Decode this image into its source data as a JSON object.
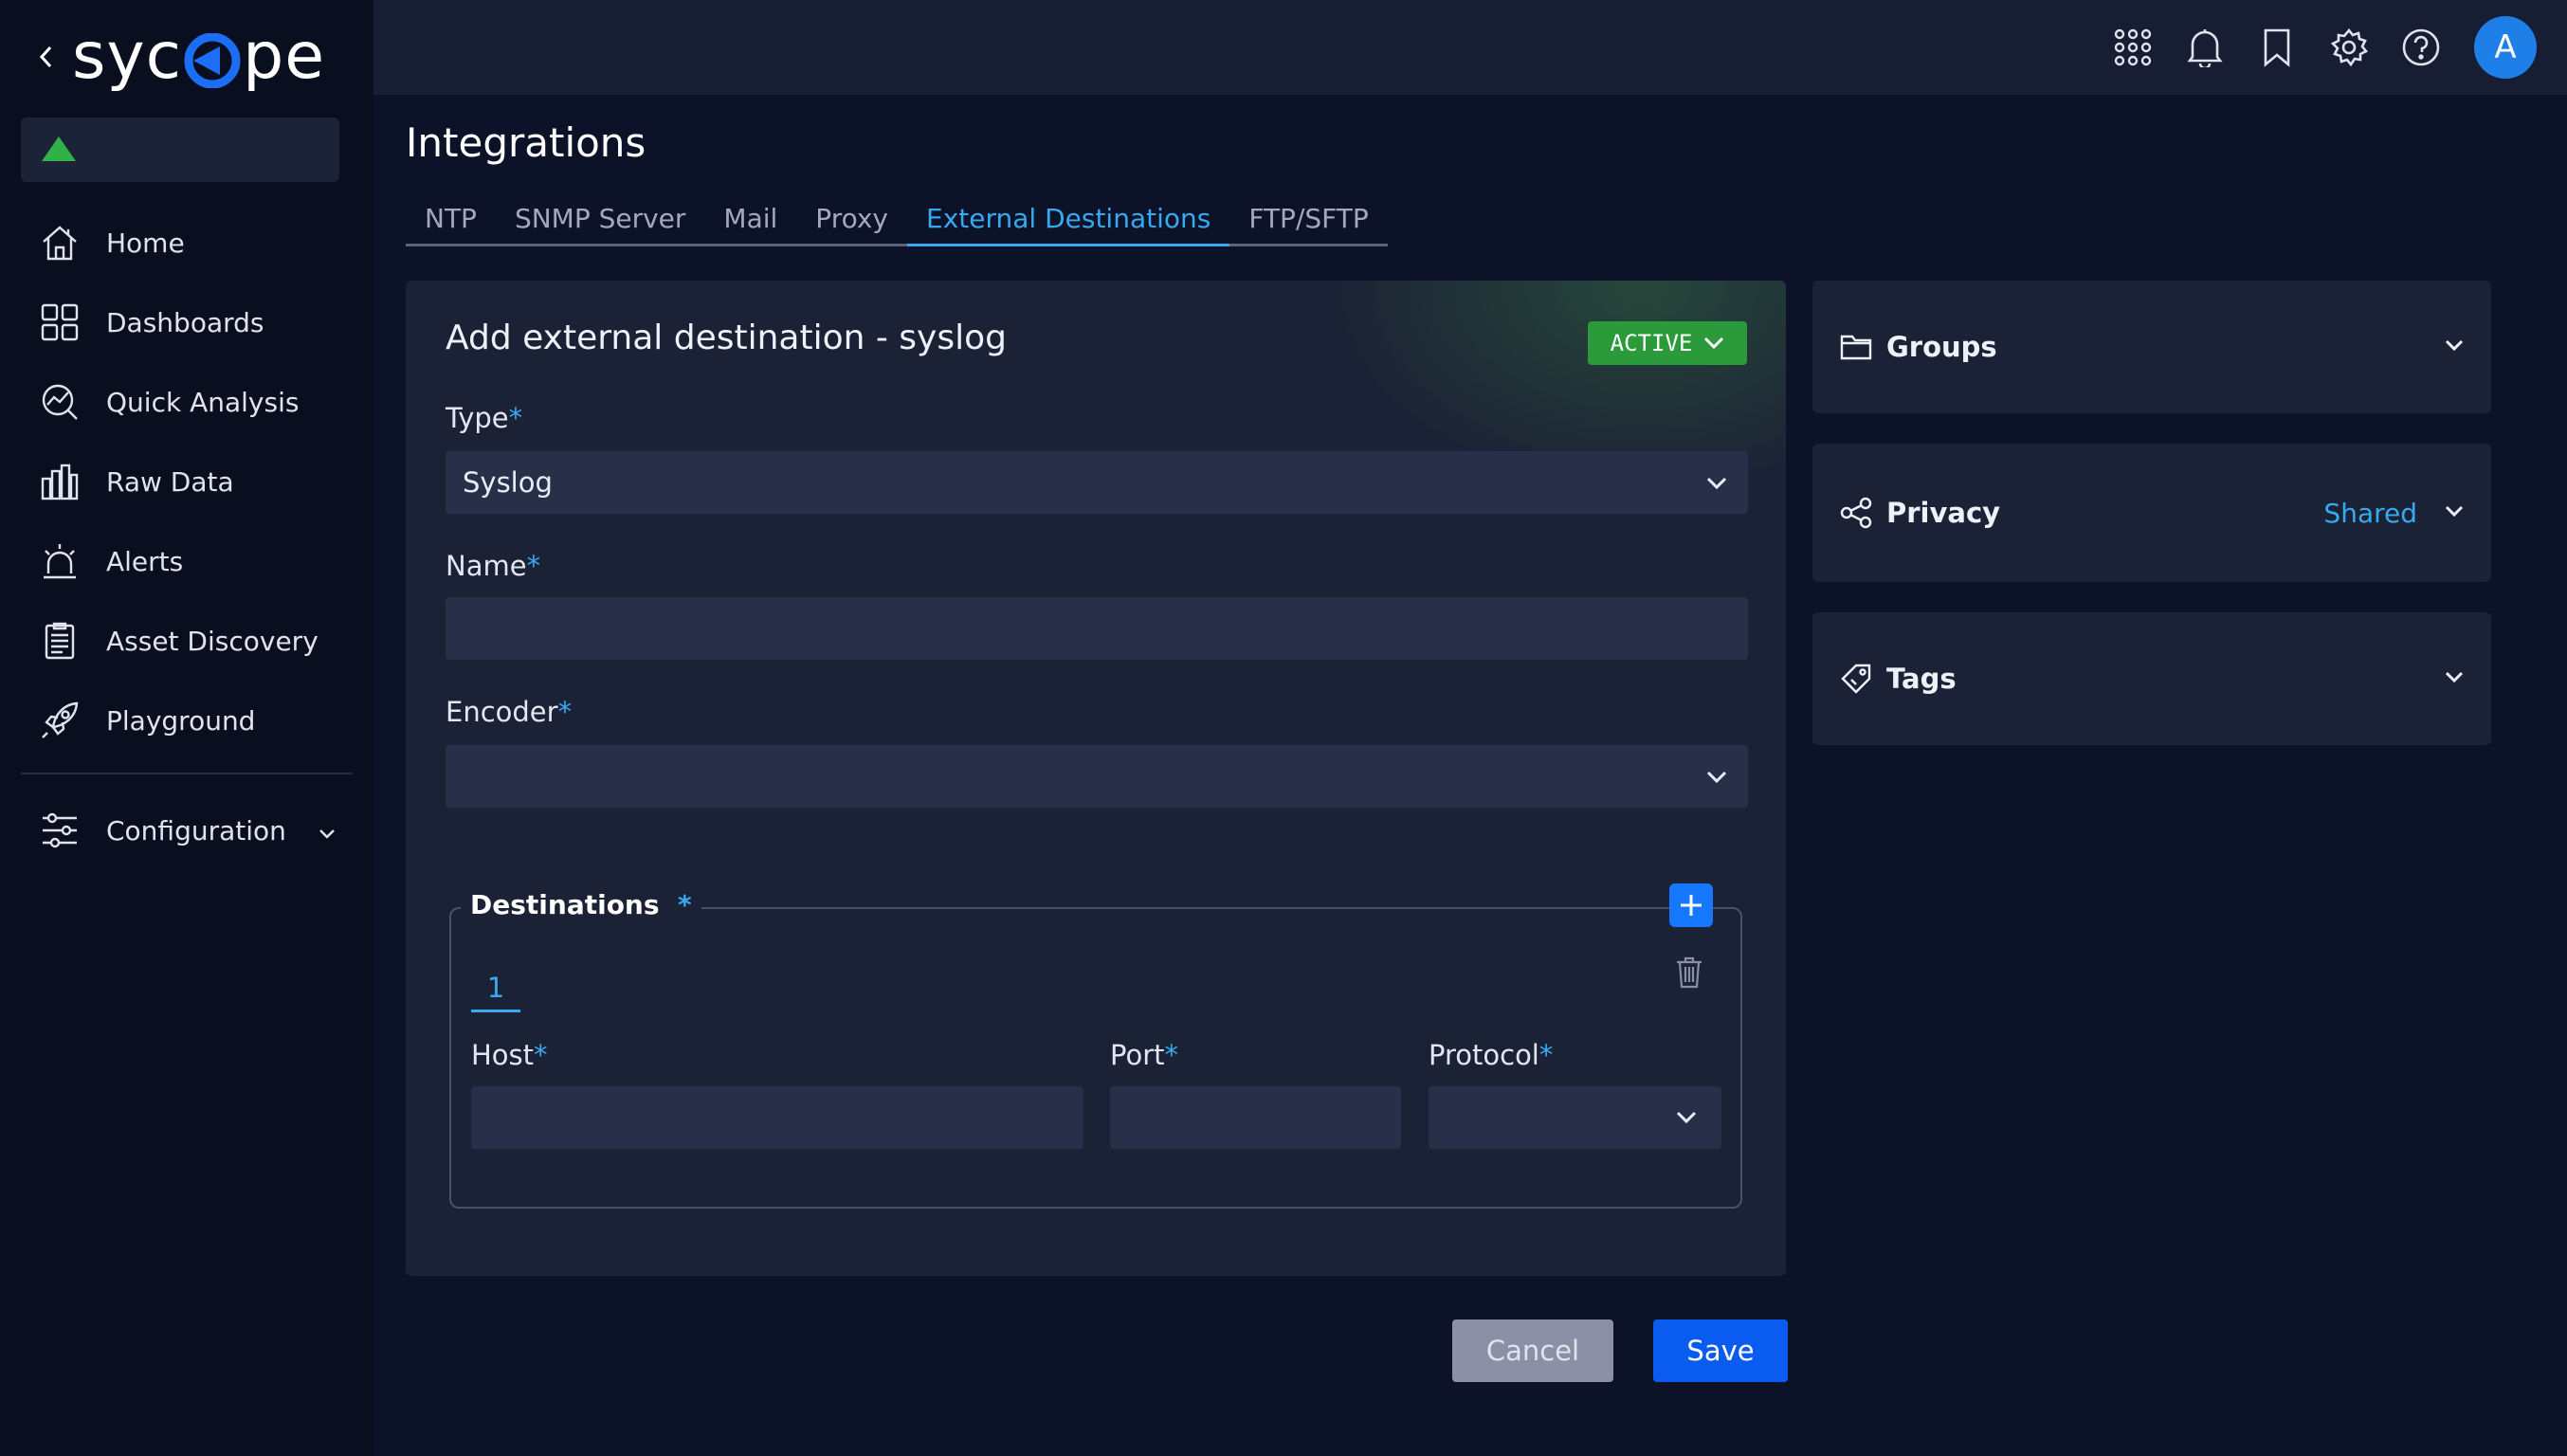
{
  "app": {
    "logo": "sycope"
  },
  "sidebar": {
    "items": [
      {
        "label": "Home",
        "icon": "home-icon"
      },
      {
        "label": "Dashboards",
        "icon": "dashboards-icon"
      },
      {
        "label": "Quick Analysis",
        "icon": "quick-analysis-icon"
      },
      {
        "label": "Raw Data",
        "icon": "raw-data-icon"
      },
      {
        "label": "Alerts",
        "icon": "alerts-icon"
      },
      {
        "label": "Asset Discovery",
        "icon": "asset-discovery-icon"
      },
      {
        "label": "Playground",
        "icon": "playground-icon"
      }
    ],
    "configuration": {
      "label": "Configuration",
      "icon": "configuration-icon"
    }
  },
  "topbar": {
    "icons": [
      "apps-grid-icon",
      "bell-icon",
      "bookmark-icon",
      "gear-icon",
      "help-icon"
    ],
    "avatar_initial": "A",
    "avatar_color": "#1f7fe8"
  },
  "page": {
    "title": "Integrations",
    "tabs": [
      {
        "label": "NTP",
        "active": false
      },
      {
        "label": "SNMP Server",
        "active": false
      },
      {
        "label": "Mail",
        "active": false
      },
      {
        "label": "Proxy",
        "active": false
      },
      {
        "label": "External Destinations",
        "active": true
      },
      {
        "label": "FTP/SFTP",
        "active": false
      }
    ]
  },
  "form": {
    "title": "Add external destination - syslog",
    "status": "ACTIVE",
    "status_color": "#2a9a3a",
    "required_marker": "*",
    "type": {
      "label": "Type",
      "value": "Syslog"
    },
    "name": {
      "label": "Name",
      "value": ""
    },
    "encoder": {
      "label": "Encoder",
      "value": ""
    },
    "destinations": {
      "legend": "Destinations",
      "tabs": [
        "1"
      ],
      "host": {
        "label": "Host",
        "value": ""
      },
      "port": {
        "label": "Port",
        "value": ""
      },
      "protocol": {
        "label": "Protocol",
        "value": ""
      }
    },
    "actions": {
      "cancel": "Cancel",
      "save": "Save"
    }
  },
  "panels": {
    "groups": {
      "title": "Groups",
      "icon": "folder-icon"
    },
    "privacy": {
      "title": "Privacy",
      "value": "Shared",
      "icon": "share-icon"
    },
    "tags": {
      "title": "Tags",
      "icon": "tag-icon"
    }
  },
  "colors": {
    "accent": "#36a9f0",
    "primary_button": "#0a5cf0"
  }
}
